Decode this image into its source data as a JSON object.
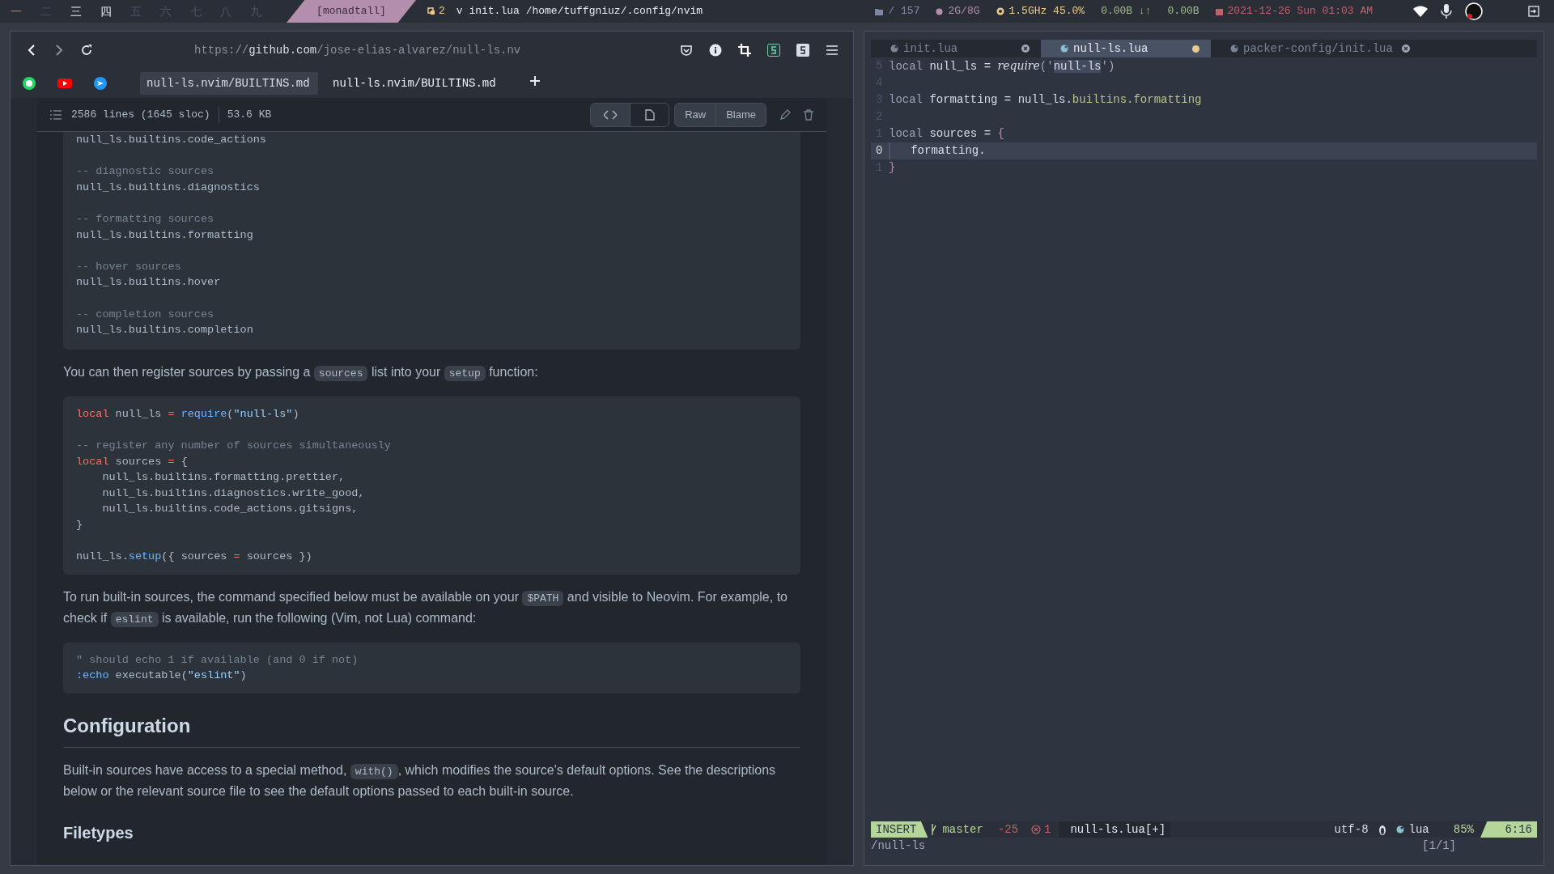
{
  "top_bar": {
    "workspaces": [
      {
        "label": "一",
        "kind": "urgent"
      },
      {
        "label": "二",
        "kind": "empty"
      },
      {
        "label": "三",
        "kind": "occupied"
      },
      {
        "label": "四",
        "kind": "occupied"
      },
      {
        "label": "五",
        "kind": "empty"
      },
      {
        "label": "六",
        "kind": "empty"
      },
      {
        "label": "七",
        "kind": "empty"
      },
      {
        "label": "八",
        "kind": "empty"
      },
      {
        "label": "九",
        "kind": "empty"
      }
    ],
    "layout": "[monadtall]",
    "window_count": "2",
    "window_title": "v init.lua /home/tuffgniuz/.config/nvim",
    "widgets": [
      {
        "kind": "disk",
        "text": "/ 157",
        "color": "#7b88a1"
      },
      {
        "kind": "memory",
        "text": "2G/8G",
        "color": "#b48ead"
      },
      {
        "kind": "cpu",
        "text": "1.5GHz 45.0%",
        "color": "#ebcb8b"
      },
      {
        "kind": "net",
        "text": "0.00B ↓↑",
        "color": "#a3be8c"
      },
      {
        "kind": "net",
        "text": "0.00B",
        "color": "#a3be8c"
      },
      {
        "kind": "date",
        "text": "2021-12-26 Sun 01:03 AM",
        "color": "#bf616a"
      }
    ]
  },
  "browser": {
    "url_dim": "https://",
    "url_host": "github.com",
    "url_path": "/jose-elias-alvarez/null-ls.nv",
    "tabs": [
      {
        "label": "null-ls.nvim/BUILTINS.md",
        "selected": true
      },
      {
        "label": "null-ls.nvim/BUILTINS.md",
        "selected": false
      }
    ],
    "file_header": {
      "lines": "2586 lines (1645 sloc)",
      "size": "53.6 KB",
      "buttons": [
        "Raw",
        "Blame"
      ]
    },
    "blocks": [
      {
        "kind": "code",
        "lines": [
          {
            "kind": "code",
            "segments": [
              {
                "kind": "plain",
                "text": "null_ls.builtins.code_actions"
              }
            ]
          },
          {
            "kind": "blank"
          },
          {
            "kind": "code",
            "segments": [
              {
                "kind": "comment",
                "text": "-- diagnostic sources"
              }
            ]
          },
          {
            "kind": "code",
            "segments": [
              {
                "kind": "plain",
                "text": "null_ls.builtins.diagnostics"
              }
            ]
          },
          {
            "kind": "blank"
          },
          {
            "kind": "code",
            "segments": [
              {
                "kind": "comment",
                "text": "-- formatting sources"
              }
            ]
          },
          {
            "kind": "code",
            "segments": [
              {
                "kind": "plain",
                "text": "null_ls.builtins.formatting"
              }
            ]
          },
          {
            "kind": "blank"
          },
          {
            "kind": "code",
            "segments": [
              {
                "kind": "comment",
                "text": "-- hover sources"
              }
            ]
          },
          {
            "kind": "code",
            "segments": [
              {
                "kind": "plain",
                "text": "null_ls.builtins.hover"
              }
            ]
          },
          {
            "kind": "blank"
          },
          {
            "kind": "code",
            "segments": [
              {
                "kind": "comment",
                "text": "-- completion sources"
              }
            ]
          },
          {
            "kind": "code",
            "segments": [
              {
                "kind": "plain",
                "text": "null_ls.builtins.completion"
              }
            ]
          }
        ]
      },
      {
        "kind": "paragraph",
        "segments": [
          {
            "kind": "text",
            "text": "You can then register sources by passing a "
          },
          {
            "kind": "code",
            "text": "sources"
          },
          {
            "kind": "text",
            "text": " list into your "
          },
          {
            "kind": "code",
            "text": "setup"
          },
          {
            "kind": "text",
            "text": " function:"
          }
        ]
      },
      {
        "kind": "code",
        "lines": [
          {
            "kind": "code",
            "segments": [
              {
                "kind": "keyword",
                "text": "local"
              },
              {
                "kind": "plain",
                "text": " null_ls "
              },
              {
                "kind": "keyword",
                "text": "="
              },
              {
                "kind": "function",
                "text": " require"
              },
              {
                "kind": "plain",
                "text": "("
              },
              {
                "kind": "string",
                "text": "\"null-ls\""
              },
              {
                "kind": "plain",
                "text": ")"
              }
            ]
          },
          {
            "kind": "blank"
          },
          {
            "kind": "code",
            "segments": [
              {
                "kind": "comment",
                "text": "-- register any number of sources simultaneously"
              }
            ]
          },
          {
            "kind": "code",
            "segments": [
              {
                "kind": "keyword",
                "text": "local"
              },
              {
                "kind": "plain",
                "text": " sources "
              },
              {
                "kind": "keyword",
                "text": "="
              },
              {
                "kind": "plain",
                "text": " {"
              }
            ]
          },
          {
            "kind": "code",
            "segments": [
              {
                "kind": "plain",
                "text": "    null_ls.builtins.formatting.prettier,"
              }
            ]
          },
          {
            "kind": "code",
            "segments": [
              {
                "kind": "plain",
                "text": "    null_ls.builtins.diagnostics.write_good,"
              }
            ]
          },
          {
            "kind": "code",
            "segments": [
              {
                "kind": "plain",
                "text": "    null_ls.builtins.code_actions.gitsigns,"
              }
            ]
          },
          {
            "kind": "code",
            "segments": [
              {
                "kind": "plain",
                "text": "}"
              }
            ]
          },
          {
            "kind": "blank"
          },
          {
            "kind": "code",
            "segments": [
              {
                "kind": "plain",
                "text": "null_ls."
              },
              {
                "kind": "function",
                "text": "setup"
              },
              {
                "kind": "plain",
                "text": "({ sources "
              },
              {
                "kind": "keyword",
                "text": "="
              },
              {
                "kind": "plain",
                "text": " sources })"
              }
            ]
          }
        ]
      },
      {
        "kind": "paragraph",
        "segments": [
          {
            "kind": "text",
            "text": "To run built-in sources, the command specified below must be available on your "
          },
          {
            "kind": "code",
            "text": "$PATH"
          },
          {
            "kind": "text",
            "text": " and visible to Neovim. For example, to check if "
          },
          {
            "kind": "code",
            "text": "eslint"
          },
          {
            "kind": "text",
            "text": " is available, run the following (Vim, not Lua) command:"
          }
        ]
      },
      {
        "kind": "code",
        "lines": [
          {
            "kind": "code",
            "segments": [
              {
                "kind": "comment",
                "text": "\" should echo 1 if available (and 0 if not)"
              }
            ]
          },
          {
            "kind": "code",
            "segments": [
              {
                "kind": "function",
                "text": ":echo"
              },
              {
                "kind": "plain",
                "text": " executable("
              },
              {
                "kind": "string",
                "text": "\"eslint\""
              },
              {
                "kind": "plain",
                "text": ")"
              }
            ]
          }
        ]
      },
      {
        "kind": "heading",
        "text": "Configuration"
      },
      {
        "kind": "paragraph",
        "segments": [
          {
            "kind": "text",
            "text": "Built-in sources have access to a special method, "
          },
          {
            "kind": "code",
            "text": "with()"
          },
          {
            "kind": "text",
            "text": ", which modifies the source's default options. See the descriptions below or the relevant source file to see the default options passed to each built-in source."
          }
        ]
      },
      {
        "kind": "subheading",
        "text": "Filetypes"
      }
    ]
  },
  "editor": {
    "tabs": [
      {
        "label": "init.lua",
        "selected": false,
        "modified": false
      },
      {
        "label": "null-ls.lua",
        "selected": true,
        "modified": true
      },
      {
        "label": "packer-config/init.lua",
        "selected": false,
        "modified": false
      }
    ],
    "lines": [
      {
        "number": "5",
        "current": false,
        "segments": [
          {
            "kind": "keyword",
            "text": "local"
          },
          {
            "kind": "plain",
            "text": " null_ls = "
          },
          {
            "kind": "italic",
            "text": "require"
          },
          {
            "kind": "punct",
            "text": "('"
          },
          {
            "kind": "match",
            "text": "null-ls"
          },
          {
            "kind": "punct",
            "text": "')"
          }
        ]
      },
      {
        "number": "4",
        "current": false
      },
      {
        "number": "3",
        "current": false,
        "segments": [
          {
            "kind": "keyword",
            "text": "local"
          },
          {
            "kind": "plain",
            "text": " formatting = null_ls."
          },
          {
            "kind": "field",
            "text": "builtins.formatting"
          }
        ]
      },
      {
        "number": "2",
        "current": false
      },
      {
        "number": "1",
        "current": false,
        "segments": [
          {
            "kind": "keyword",
            "text": "local"
          },
          {
            "kind": "plain",
            "text": " sources = "
          },
          {
            "kind": "brace",
            "text": "{"
          }
        ]
      },
      {
        "number": "0",
        "current": true,
        "segments": [
          {
            "kind": "plain",
            "text": "   formatting."
          }
        ]
      },
      {
        "number": "1",
        "current": false,
        "segments": [
          {
            "kind": "brace",
            "text": "}"
          }
        ]
      }
    ],
    "status": {
      "mode": "INSERT",
      "branch": "master",
      "diff": "-25",
      "errors": "1",
      "file": "null-ls.lua[+]",
      "encoding": "utf-8",
      "filetype": "lua",
      "percent": "85%",
      "position": "6:16"
    },
    "command_line": "/null-ls",
    "search_count": "[1/1]"
  }
}
